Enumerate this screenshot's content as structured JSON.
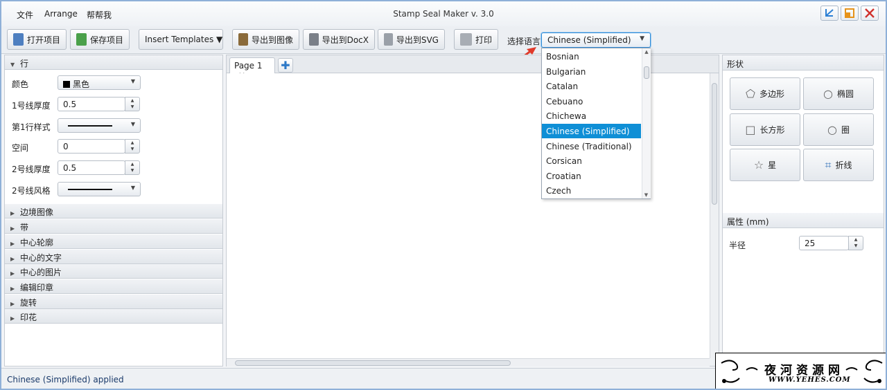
{
  "menu": {
    "file": "文件",
    "arrange": "Arrange",
    "help": "帮帮我"
  },
  "window": {
    "title": "Stamp Seal Maker v. 3.0"
  },
  "toolbar": {
    "open": "打开项目",
    "save": "保存项目",
    "templates": "Insert Templates ▼",
    "export_image": "导出到图像",
    "export_docx": "导出到DocX",
    "export_svg": "导出到SVG",
    "print": "打印",
    "language_label": "选择语言",
    "language_value": "Chinese (Simplified)"
  },
  "language_options": [
    "Bosnian",
    "Bulgarian",
    "Catalan",
    "Cebuano",
    "Chichewa",
    "Chinese (Simplified)",
    "Chinese (Traditional)",
    "Corsican",
    "Croatian",
    "Czech"
  ],
  "language_selected": "Chinese (Simplified)",
  "left": {
    "line_section": "行",
    "color_label": "颜色",
    "color_value": "黑色",
    "thickness1_label": "1号线厚度",
    "thickness1_value": "0.5",
    "style1_label": "第1行样式",
    "space_label": "空间",
    "space_value": "0",
    "thickness2_label": "2号线厚度",
    "thickness2_value": "0.5",
    "style2_label": "2号线风格",
    "sections": [
      "边境图像",
      "带",
      "中心轮廓",
      "中心的文字",
      "中心的图片",
      "编辑印章",
      "旋转",
      "印花"
    ]
  },
  "center": {
    "tab_label": "Page 1"
  },
  "right": {
    "shapes_header": "形状",
    "shapes": [
      "多边形",
      "椭圆",
      "长方形",
      "圈",
      "星",
      "折线"
    ],
    "props_header": "属性 (mm)",
    "radius_label": "半径",
    "radius_value": "25"
  },
  "status": {
    "text": "Chinese (Simplified) applied"
  },
  "watermark": {
    "title": "夜河资源网",
    "url": "WWW.YEHES.COM"
  }
}
